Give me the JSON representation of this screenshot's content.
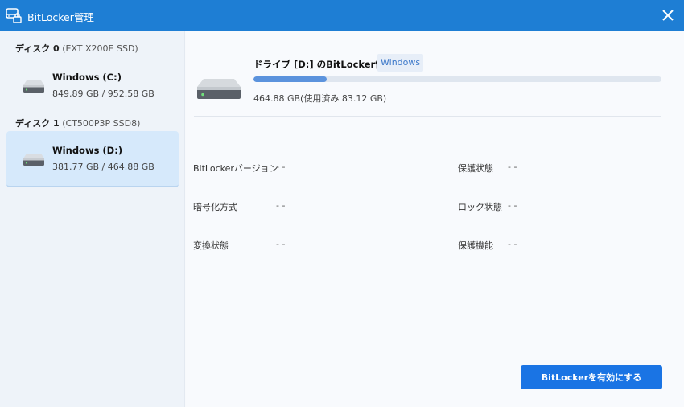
{
  "window": {
    "title": "BitLocker管理",
    "app_icon": "drive-lock-icon",
    "close_icon": "close-icon"
  },
  "sidebar": {
    "disks": [
      {
        "label": "ディスク 0",
        "model": "(EXT X200E SSD)",
        "drives": [
          {
            "name": "Windows (C:)",
            "size": "849.89 GB / 952.58 GB",
            "icon": "drive-icon",
            "selected": false
          }
        ]
      },
      {
        "label": "ディスク 1",
        "model": "(CT500P3P SSD8)",
        "drives": [
          {
            "name": "Windows (D:)",
            "size": "381.77 GB / 464.88 GB",
            "icon": "drive-icon",
            "selected": true
          }
        ]
      }
    ]
  },
  "detail": {
    "title": "ドライブ [D:] のBitLocker情報",
    "badge": "Windows",
    "usage_fraction": 0.179,
    "usage_text": "464.88 GB(使用済み 83.12 GB)",
    "properties": [
      {
        "label": "BitLockerバージョン",
        "value": "- -"
      },
      {
        "label": "保護状態",
        "value": "- -"
      },
      {
        "label": "暗号化方式",
        "value": "- -"
      },
      {
        "label": "ロック状態",
        "value": "- -"
      },
      {
        "label": "変換状態",
        "value": "- -"
      },
      {
        "label": "保護機能",
        "value": "- -"
      }
    ],
    "enable_button": "BitLockerを有効にする"
  },
  "colors": {
    "titlebar": "#1e7ed4",
    "accent": "#1a74e4",
    "progress_fill": "#5b93dd",
    "selected_bg": "#d6e9fb"
  }
}
